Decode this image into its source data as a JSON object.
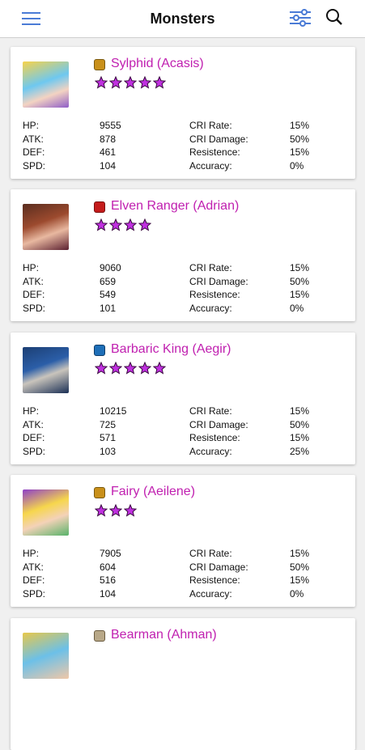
{
  "header": {
    "title": "Monsters"
  },
  "stat_labels": {
    "hp": "HP:",
    "atk": "ATK:",
    "def": "DEF:",
    "spd": "SPD:",
    "cri_rate": "CRI Rate:",
    "cri_damage": "CRI Damage:",
    "resistance": "Resistence:",
    "accuracy": "Accuracy:"
  },
  "monsters": [
    {
      "name": "Sylphid (Acasis)",
      "element": "wind",
      "stars": 5,
      "hp": "9555",
      "atk": "878",
      "def": "461",
      "spd": "104",
      "cri_rate": "15%",
      "cri_damage": "50%",
      "resistance": "15%",
      "accuracy": "0%"
    },
    {
      "name": "Elven Ranger (Adrian)",
      "element": "fire",
      "stars": 4,
      "hp": "9060",
      "atk": "659",
      "def": "549",
      "spd": "101",
      "cri_rate": "15%",
      "cri_damage": "50%",
      "resistance": "15%",
      "accuracy": "0%"
    },
    {
      "name": "Barbaric King (Aegir)",
      "element": "water",
      "stars": 5,
      "hp": "10215",
      "atk": "725",
      "def": "571",
      "spd": "103",
      "cri_rate": "15%",
      "cri_damage": "50%",
      "resistance": "15%",
      "accuracy": "25%"
    },
    {
      "name": "Fairy (Aeilene)",
      "element": "wind",
      "stars": 3,
      "hp": "7905",
      "atk": "604",
      "def": "516",
      "spd": "104",
      "cri_rate": "15%",
      "cri_damage": "50%",
      "resistance": "15%",
      "accuracy": "0%"
    },
    {
      "name": "Bearman (Ahman)",
      "element": "wind-gray",
      "stars": 0
    }
  ],
  "colors": {
    "accent": "#4a7bd6",
    "monster_name": "#c020b0",
    "star": "#c030e0"
  }
}
